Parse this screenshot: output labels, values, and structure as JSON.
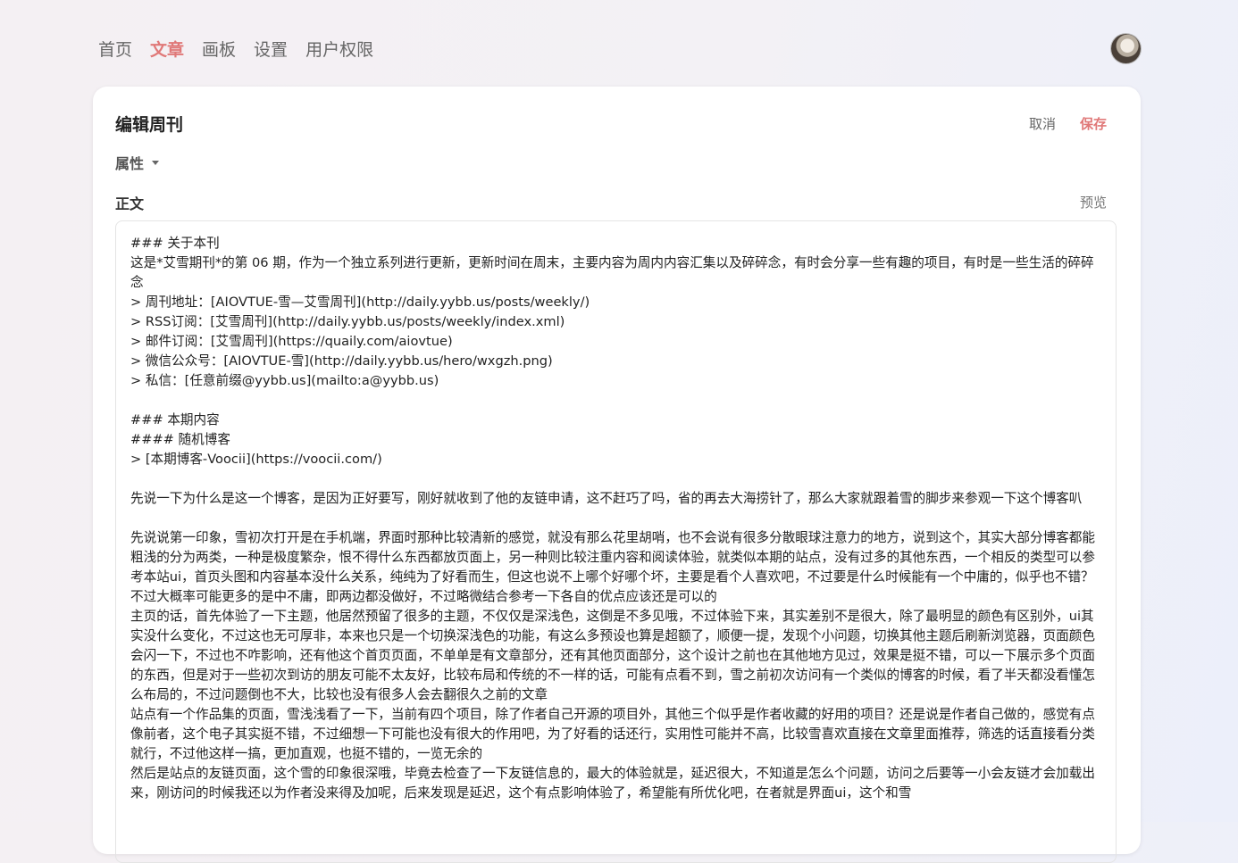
{
  "nav": {
    "items": [
      {
        "label": "首页",
        "active": false
      },
      {
        "label": "文章",
        "active": true
      },
      {
        "label": "画板",
        "active": false
      },
      {
        "label": "设置",
        "active": false
      },
      {
        "label": "用户权限",
        "active": false
      }
    ]
  },
  "header": {
    "title": "编辑周刊",
    "cancel_label": "取消",
    "save_label": "保存"
  },
  "properties": {
    "label": "属性"
  },
  "body_section": {
    "label": "正文",
    "preview_label": "预览"
  },
  "editor": {
    "lines": [
      "### 关于本刊",
      "这是*艾雪期刊*的第 06 期，作为一个独立系列进行更新，更新时间在周末，主要内容为周内内容汇集以及碎碎念，有时会分享一些有趣的项目，有时是一些生活的碎碎念",
      "> 周刊地址：[AIOVTUE-雪—艾雪周刊](http://daily.yybb.us/posts/weekly/)",
      "> RSS订阅：[艾雪周刊](http://daily.yybb.us/posts/weekly/index.xml)",
      "> 邮件订阅：[艾雪周刊](https://quaily.com/aiovtue)",
      "> 微信公众号：[AIOVTUE-雪](http://daily.yybb.us/hero/wxgzh.png)",
      "> 私信：[任意前缀@yybb.us](mailto:a@yybb.us)",
      "",
      "### 本期内容",
      "#### 随机博客",
      "> [本期博客-Voocii](https://voocii.com/)",
      "",
      "先说一下为什么是这一个博客，是因为正好要写，刚好就收到了他的友链申请，这不赶巧了吗，省的再去大海捞针了，那么大家就跟着雪的脚步来参观一下这个博客叭",
      "",
      "先说说第一印象，雪初次打开是在手机端，界面时那种比较清新的感觉，就没有那么花里胡哨，也不会说有很多分散眼球注意力的地方，说到这个，其实大部分博客都能粗浅的分为两类，一种是极度繁杂，恨不得什么东西都放页面上，另一种则比较注重内容和阅读体验，就类似本期的站点，没有过多的其他东西，一个相反的类型可以参考本站ui，首页头图和内容基本没什么关系，纯纯为了好看而生，但这也说不上哪个好哪个坏，主要是看个人喜欢吧，不过要是什么时候能有一个中庸的，似乎也不错？不过大概率可能更多的是中不庸，即两边都没做好，不过略微结合参考一下各自的优点应该还是可以的",
      "主页的话，首先体验了一下主题，他居然预留了很多的主题，不仅仅是深浅色，这倒是不多见哦，不过体验下来，其实差别不是很大，除了最明显的颜色有区别外，ui其实没什么变化，不过这也无可厚非，本来也只是一个切换深浅色的功能，有这么多预设也算是超额了，顺便一提，发现个小问题，切换其他主题后刷新浏览器，页面颜色会闪一下，不过也不咋影响，还有他这个首页页面，不单单是有文章部分，还有其他页面部分，这个设计之前也在其他地方见过，效果是挺不错，可以一下展示多个页面的东西，但是对于一些初次到访的朋友可能不太友好，比较布局和传统的不一样的话，可能有点看不到，雪之前初次访问有一个类似的博客的时候，看了半天都没看懂怎么布局的，不过问题倒也不大，比较也没有很多人会去翻很久之前的文章",
      "站点有一个作品集的页面，雪浅浅看了一下，当前有四个项目，除了作者自己开源的项目外，其他三个似乎是作者收藏的好用的项目？还是说是作者自己做的，感觉有点像前者，这个电子其实挺不错，不过细想一下可能也没有很大的作用吧，为了好看的话还行，实用性可能并不高，比较雪喜欢直接在文章里面推荐，筛选的话直接看分类就行，不过他这样一搞，更加直观，也挺不错的，一览无余的",
      "然后是站点的友链页面，这个雪的印象很深哦，毕竟去检查了一下友链信息的，最大的体验就是，延迟很大，不知道是怎么个问题，访问之后要等一小会友链才会加载出来，刚访问的时候我还以为作者没来得及加呢，后来发现是延迟，这个有点影响体验了，希望能有所优化吧，在者就是界面ui，这个和雪"
    ]
  }
}
